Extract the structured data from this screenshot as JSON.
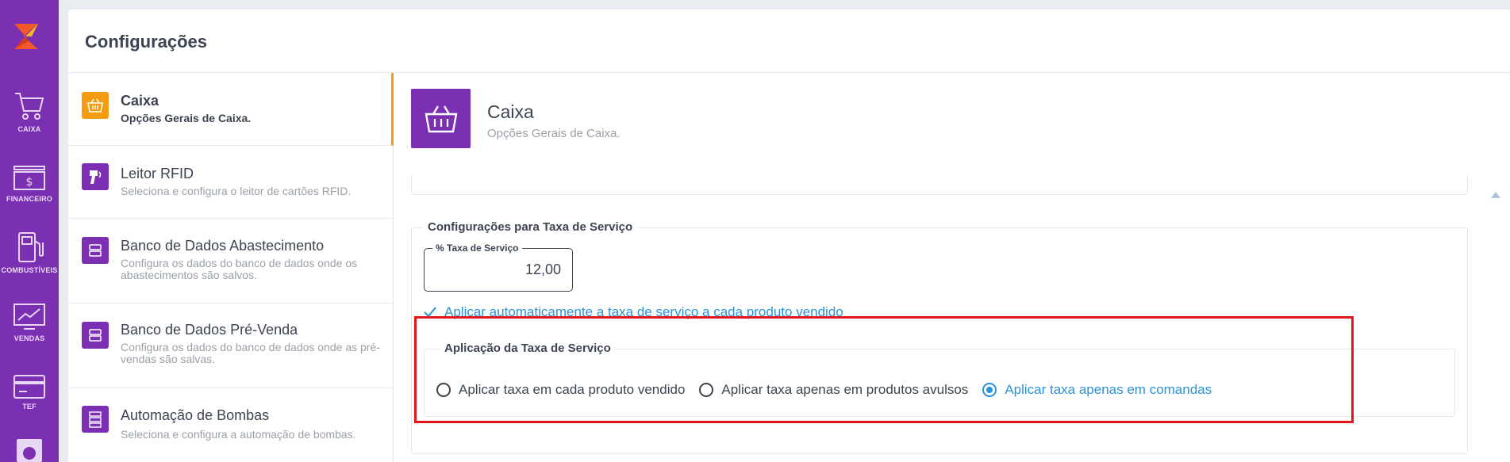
{
  "nav": {
    "items": [
      {
        "label": "CAIXA",
        "icon": "cart-icon"
      },
      {
        "label": "FINANCEIRO",
        "icon": "money-icon"
      },
      {
        "label": "COMBUSTÍVEIS",
        "icon": "fuel-pump-icon"
      },
      {
        "label": "VENDAS",
        "icon": "chart-icon"
      },
      {
        "label": "TEF",
        "icon": "card-icon"
      }
    ]
  },
  "page": {
    "title": "Configurações"
  },
  "settings": [
    {
      "title": "Caixa",
      "desc": "Opções Gerais de Caixa.",
      "icon": "basket-icon",
      "active": true
    },
    {
      "title": "Leitor RFID",
      "desc": "Seleciona e configura o leitor de cartões RFID.",
      "icon": "rfid-reader-icon"
    },
    {
      "title": "Banco de Dados Abastecimento",
      "desc": "Configura os dados do banco de dados onde os abastecimentos são salvos.",
      "icon": "database-icon"
    },
    {
      "title": "Banco de Dados Pré-Venda",
      "desc": "Configura os dados do banco de dados onde as pré-vendas são salvas.",
      "icon": "database-icon"
    },
    {
      "title": "Automação de Bombas",
      "desc": "Seleciona e configura a automação de bombas.",
      "icon": "server-icon"
    }
  ],
  "detail": {
    "title": "Caixa",
    "subtitle": "Opções Gerais de Caixa.",
    "service_fee": {
      "legend": "Configurações para Taxa de Serviço",
      "input_label": "% Taxa de Serviço",
      "input_value": "12,00",
      "auto_apply_label": "Aplicar automaticamente a taxa de serviço a cada produto vendido",
      "auto_apply_checked": true
    },
    "application": {
      "legend": "Aplicação da Taxa de Serviço",
      "options": [
        {
          "label": "Aplicar taxa em cada produto vendido",
          "checked": false
        },
        {
          "label": "Aplicar taxa apenas em produtos avulsos",
          "checked": false
        },
        {
          "label": "Aplicar taxa apenas em comandas",
          "checked": true
        }
      ]
    }
  },
  "colors": {
    "rail": "#7b2fb3",
    "accent_orange": "#f39c12",
    "link_blue": "#2a93d5",
    "highlight_red": "#e3161b"
  }
}
